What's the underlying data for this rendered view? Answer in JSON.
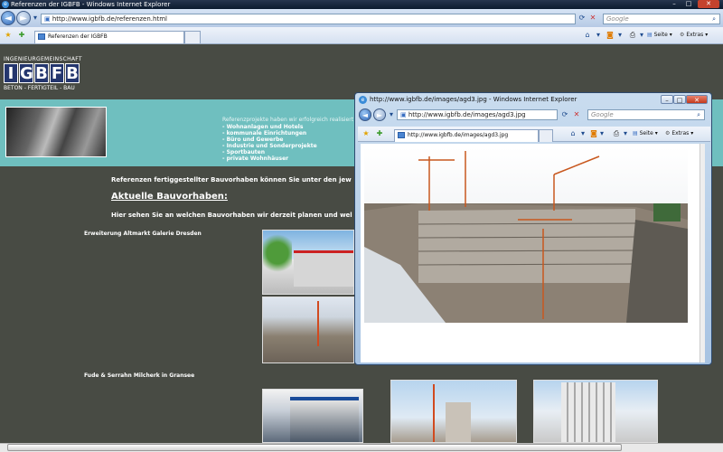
{
  "main_window": {
    "title": "Referenzen der IGBFB - Windows Internet Explorer",
    "url": "http://www.igbfb.de/referenzen.html",
    "search_placeholder": "Google",
    "tab_label": "Referenzen der IGBFB",
    "commands": {
      "page": "Seite",
      "extras": "Extras"
    }
  },
  "logo": {
    "top": "INGENIEURGEMEINSCHAFT",
    "letters": [
      "I",
      "G",
      "B",
      "F",
      "B"
    ],
    "bottom": "BETON - FERTIGTEIL - BAU"
  },
  "banner": {
    "intro": "Referenzprojekte haben wir erfolgreich realisiert",
    "items": [
      "- Wohnanlagen und Hotels",
      "- kommunale Einrichtungen",
      "- Büro und Gewerbe",
      "- Industrie und Sonderprojekte",
      "- Sportbauten",
      "- private Wohnhäuser"
    ]
  },
  "content": {
    "ref_text": "Referenzen fertiggestellter Bauvorhaben können Sie unter den jew",
    "heading": "Aktuelle Bauvorhaben:",
    "sub_text": "Hier sehen Sie an welchen Bauvorhaben wir derzeit planen und wel",
    "project1": "Erweiterung Altmarkt Galerie Dresden",
    "project2": "Fude & Serrahn Milcherk in Gransee"
  },
  "popup": {
    "title": "http://www.igbfb.de/images/agd3.jpg - Windows Internet Explorer",
    "url": "http://www.igbfb.de/images/agd3.jpg",
    "search_placeholder": "Google",
    "tab_label": "http://www.igbfb.de/images/agd3.jpg",
    "commands": {
      "page": "Seite",
      "extras": "Extras"
    }
  }
}
